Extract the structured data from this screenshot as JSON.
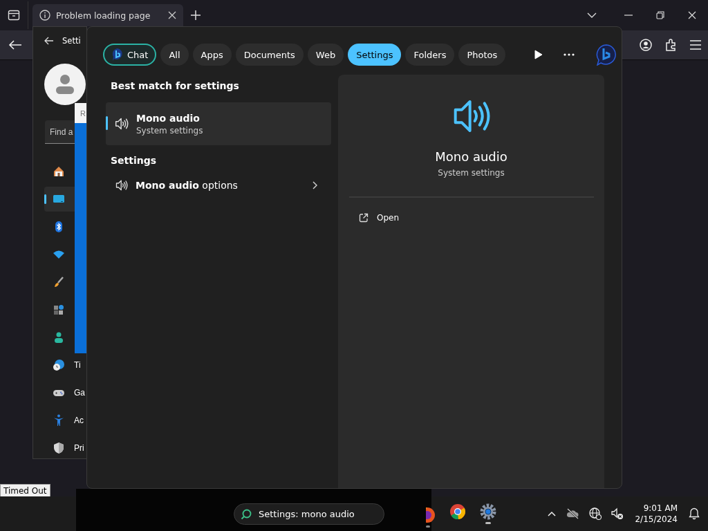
{
  "browser": {
    "tabs": [
      {
        "title": "Problem loading page",
        "selected": true
      }
    ]
  },
  "settings_window": {
    "title": "Setti",
    "search": {
      "placeholder": "Find a"
    },
    "popup": {
      "title": "R"
    },
    "nav": [
      {
        "selected": false
      },
      {
        "selected": true
      },
      {
        "selected": false
      },
      {
        "selected": false
      },
      {
        "selected": false
      },
      {
        "selected": false
      },
      {
        "selected": false
      },
      {
        "label": "Ti",
        "selected": false
      },
      {
        "label": "Ga",
        "selected": false
      },
      {
        "label": "Ac",
        "selected": false
      },
      {
        "label": "Pri",
        "selected": false
      }
    ]
  },
  "search_flyout": {
    "filters": [
      {
        "label": "Chat",
        "kind": "chat",
        "selected": false,
        "focused": true
      },
      {
        "label": "All",
        "kind": "text",
        "selected": false,
        "focused": false
      },
      {
        "label": "Apps",
        "kind": "text",
        "selected": false,
        "focused": false
      },
      {
        "label": "Documents",
        "kind": "text",
        "selected": false,
        "focused": false
      },
      {
        "label": "Web",
        "kind": "text",
        "selected": false,
        "focused": false
      },
      {
        "label": "Settings",
        "kind": "text",
        "selected": true,
        "focused": false
      },
      {
        "label": "Folders",
        "kind": "text",
        "selected": false,
        "focused": false
      },
      {
        "label": "Photos",
        "kind": "text",
        "selected": false,
        "focused": false
      }
    ],
    "best_match": {
      "heading": "Best match for settings",
      "item": {
        "title": "Mono audio",
        "subtitle": "System settings",
        "selected": true
      }
    },
    "settings_section": {
      "heading": "Settings",
      "items": [
        {
          "title": "**Mono audio** options"
        }
      ]
    },
    "preview": {
      "title": "Mono audio",
      "subtitle": "System settings",
      "actions": [
        {
          "label": "Open"
        }
      ]
    }
  },
  "tooltip": {
    "text": "Timed Out"
  },
  "taskbar": {
    "search": {
      "value": "Settings: mono audio"
    },
    "apps": [
      {
        "kind": "firefox",
        "running": true,
        "active": false
      },
      {
        "kind": "chrome",
        "running": false,
        "active": false
      },
      {
        "kind": "settings",
        "running": true,
        "active": true
      }
    ],
    "clock": {
      "time": "9:01 AM",
      "date": "2/15/2024"
    }
  }
}
